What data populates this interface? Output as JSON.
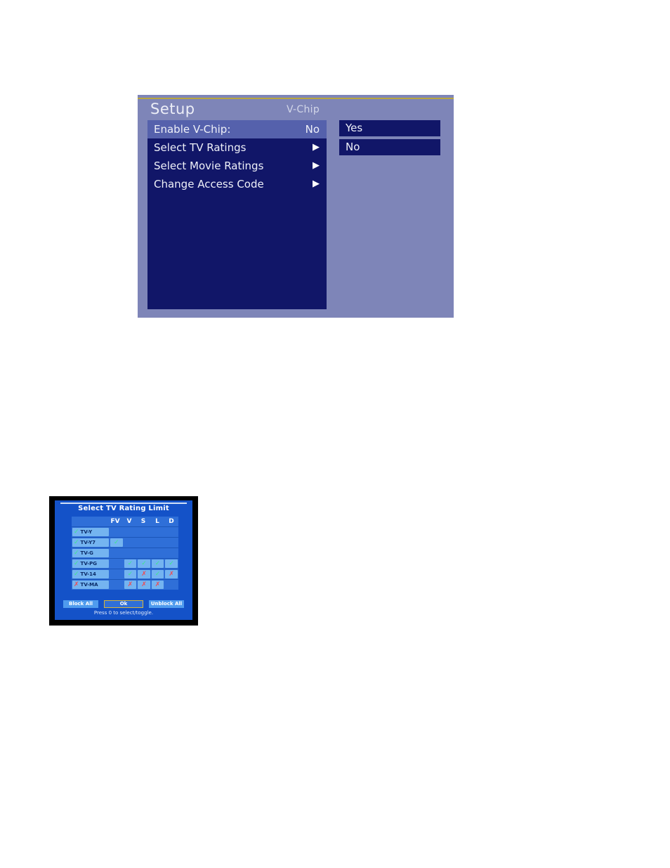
{
  "osd": {
    "title": "Setup",
    "subtitle": "V-Chip",
    "menu_items": [
      {
        "label": "Enable V-Chip:",
        "value": "No",
        "arrow": "",
        "selected": true
      },
      {
        "label": "Select TV Ratings",
        "value": "",
        "arrow": "▶",
        "selected": false
      },
      {
        "label": "Select Movie Ratings",
        "value": "",
        "arrow": "▶",
        "selected": false
      },
      {
        "label": "Change Access Code",
        "value": "",
        "arrow": "▶",
        "selected": false
      }
    ],
    "options": [
      {
        "label": "Yes"
      },
      {
        "label": "No"
      }
    ],
    "colors": {
      "panel_bg": "#7e85b8",
      "list_bg": "#111668",
      "selected_row": "#5561ac",
      "gold_rule": "#b9a53f",
      "text": "#eef0f8"
    }
  },
  "photo": {
    "title": "Select TV Rating Limit",
    "columns": [
      "FV",
      "V",
      "S",
      "L",
      "D"
    ],
    "rows": [
      {
        "label": "TV-Y",
        "label_mark": "check",
        "cells": [
          "",
          "",
          "",
          "",
          ""
        ]
      },
      {
        "label": "TV-Y7",
        "label_mark": "check",
        "cells": [
          "check",
          "",
          "",
          "",
          ""
        ]
      },
      {
        "label": "TV-G",
        "label_mark": "check",
        "cells": [
          "",
          "",
          "",
          "",
          ""
        ]
      },
      {
        "label": "TV-PG",
        "label_mark": "check",
        "cells": [
          "",
          "check",
          "check",
          "check",
          "check"
        ]
      },
      {
        "label": "TV-14",
        "label_mark": "check",
        "cells": [
          "",
          "check",
          "x",
          "check",
          "x"
        ]
      },
      {
        "label": "TV-MA",
        "label_mark": "x",
        "cells": [
          "",
          "x",
          "x",
          "x",
          ""
        ]
      }
    ],
    "buttons": {
      "block_all": "Block All",
      "ok": "Ok",
      "unblock_all": "Unblock All"
    },
    "hint": "Press 0 to select/toggle.",
    "colors": {
      "screen_bg": "#1452c8",
      "grid_bg": "#2f6fd8",
      "cell_on": "#74b4f0",
      "check": "#3ce88a",
      "x": "#ef4a52",
      "bezel": "#000000"
    }
  }
}
